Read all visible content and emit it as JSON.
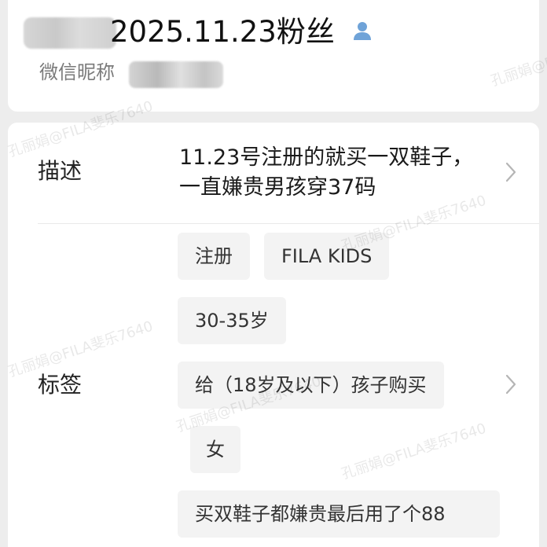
{
  "header": {
    "title": "2025.11.23粉丝",
    "nickname_label": "微信昵称"
  },
  "detail": {
    "description_label": "描述",
    "description_text": "11.23号注册的就买一双鞋子，一直嫌贵男孩穿37码",
    "tags_label": "标签",
    "tags": [
      "注册",
      "FILA KIDS",
      "30-35岁",
      "给（18岁及以下）孩子购买",
      "女",
      "买双鞋子都嫌贵最后用了个88"
    ]
  },
  "watermarks": [
    "孔丽娟@FILA斐乐7640",
    "孔丽娟@FILA斐乐7640",
    "孔丽娟@FILA斐乐7640",
    "孔丽娟@FILA斐乐7640",
    "孔丽娟@FILA斐乐7640",
    "孔丽娟@FILA斐乐7640"
  ],
  "colors": {
    "background": "#ededed",
    "card": "#ffffff",
    "tag_bg": "#f3f3f3",
    "icon_blue": "#6fa3d8"
  }
}
